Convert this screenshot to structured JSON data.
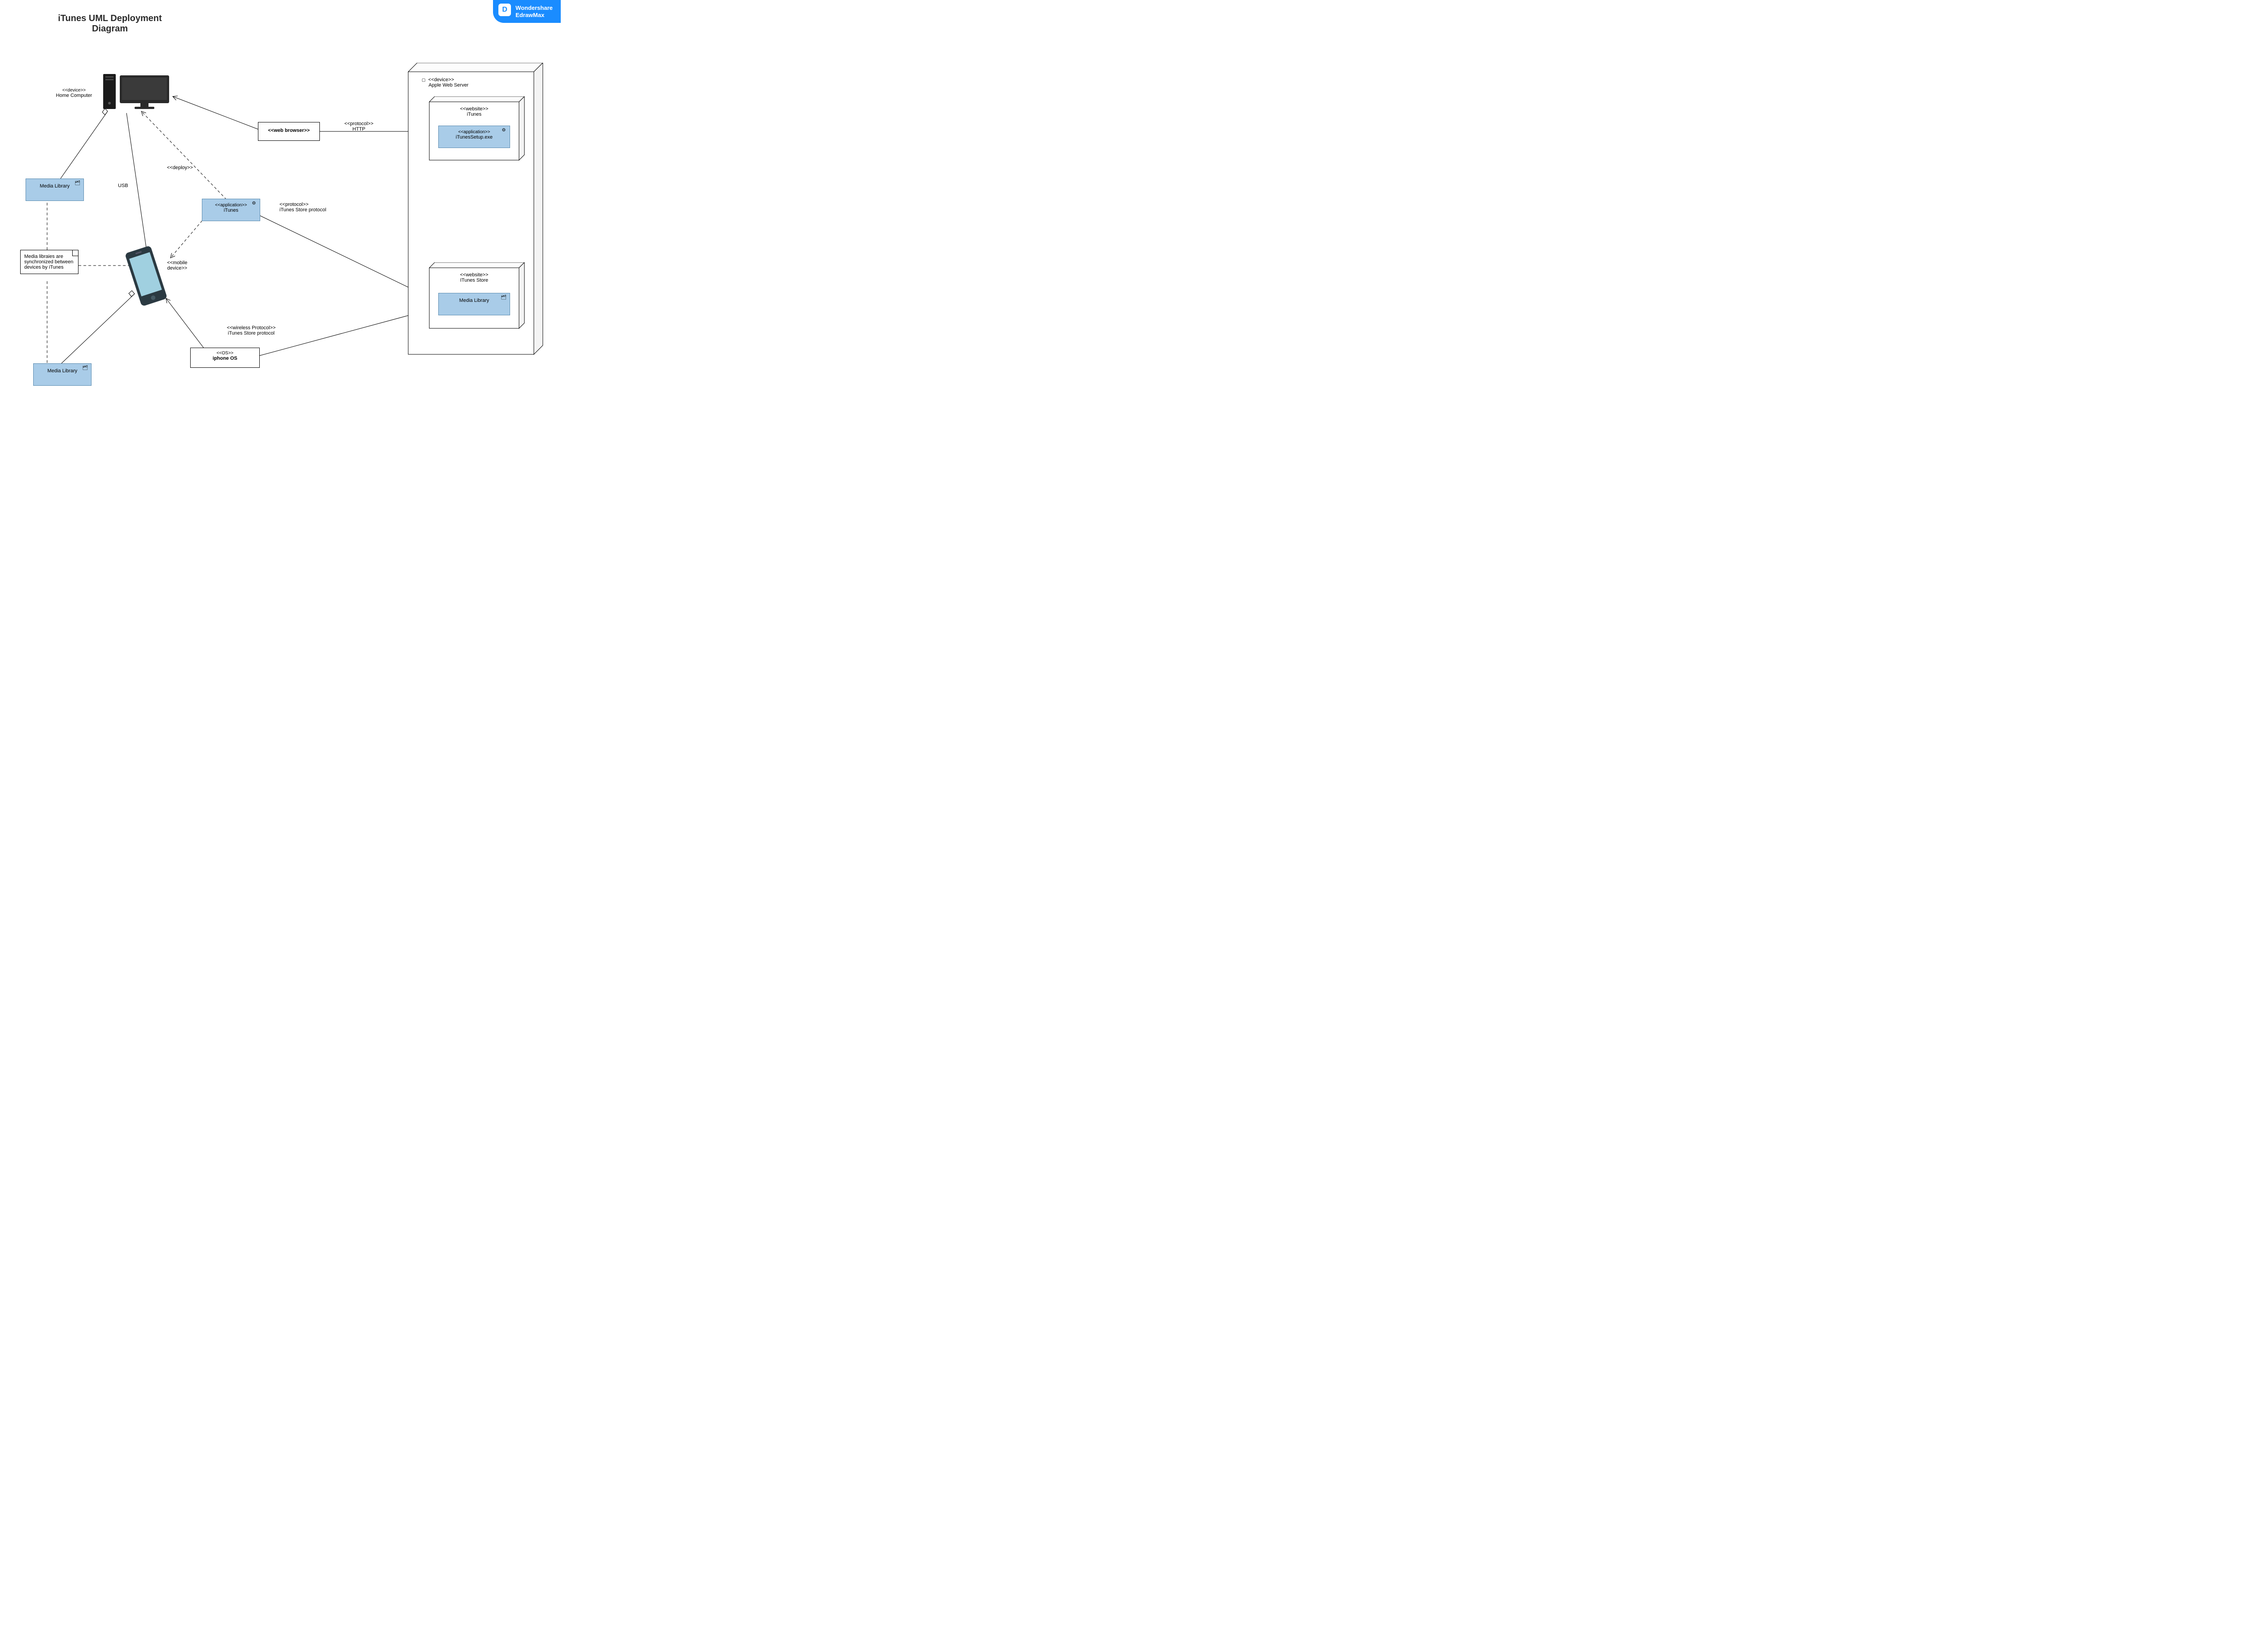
{
  "title": "iTunes UML Deployment Diagram",
  "brand": {
    "name": "Wondershare",
    "product": "EdrawMax",
    "icon": "D"
  },
  "nodes": {
    "homeComputer": {
      "stereotype": "<<device>>",
      "label": "Home Computer"
    },
    "mediaLibrary1": {
      "label": "Media Library"
    },
    "mediaLibrary2": {
      "label": "Media Library"
    },
    "mediaLibrary3": {
      "label": "Media Library"
    },
    "itunesApp": {
      "stereotype": "<<application>>",
      "label": "iTunes"
    },
    "iphoneOS": {
      "stereotype": "<<OS>>",
      "label": "iphone OS"
    },
    "webBrowser": {
      "label": "<<web browser>>"
    },
    "mobileDevice": {
      "stereotype": "<<mobile device>>"
    },
    "appleWebServer": {
      "stereotype": "<<device>>",
      "label": "Apple Web Server"
    },
    "itunesWebsite": {
      "stereotype": "<<website>>",
      "label": "iTunes"
    },
    "itunesSetup": {
      "stereotype": "<<application>>",
      "label": "iTunesSetup.exe"
    },
    "itunesStore": {
      "stereotype": "<<website>>",
      "label": "ITunes Store"
    }
  },
  "edges": {
    "deploy": "<<deploy>>",
    "usb": "USB",
    "http": {
      "stereotype": "<<protocol>>",
      "label": "HTTP"
    },
    "itunesProtocol": {
      "stereotype": "<<protocol>>",
      "label": "iTunes Store protocol"
    },
    "wirelessProtocol": {
      "stereotype": "<<wireless Protocol>>",
      "label": "iTunes Store protocol"
    }
  },
  "note": "Media libraies are synchronized between devices by iTunes"
}
